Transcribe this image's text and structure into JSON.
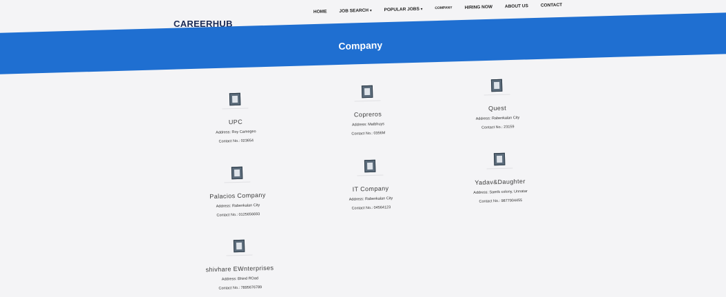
{
  "header": {
    "brand": "CAREERHUB",
    "nav": [
      {
        "label": "HOME",
        "caret": ""
      },
      {
        "label": "JOB SEARCH",
        "caret": "▾"
      },
      {
        "label": "POPULAR JOBS",
        "caret": "▾"
      },
      {
        "label": "COMPANY",
        "caret": ""
      },
      {
        "label": "HIRING NOW",
        "caret": ""
      },
      {
        "label": "ABOUT US",
        "caret": ""
      },
      {
        "label": "CONTACT",
        "caret": ""
      }
    ]
  },
  "banner": {
    "title": "Company"
  },
  "companies": [
    {
      "name": "UPC",
      "address": "Address: Roy Camegeo",
      "contact": "Contact No.: 023654"
    },
    {
      "name": "Copreros",
      "address": "Address: Matbhuys",
      "contact": "Contact No.: 0356M"
    },
    {
      "name": "Quest",
      "address": "Address: Rabenkalan City",
      "contact": "Contact No.: 23159"
    },
    {
      "name": "Palacios Company",
      "address": "Address: Rabenkalan City",
      "contact": "Contact No.: 0125656693"
    },
    {
      "name": "IT Company",
      "address": "Address: Rabenkalan City",
      "contact": "Contact No.: 04564123"
    },
    {
      "name": "Yadav&Daughter",
      "address": "Address: Saerik colony, Unnatar",
      "contact": "Contact No.: 9877904455"
    },
    {
      "name": "shivhare EWnterprises",
      "address": "Address: Bhind ROad",
      "contact": "Contact No.: 7895676789"
    }
  ]
}
